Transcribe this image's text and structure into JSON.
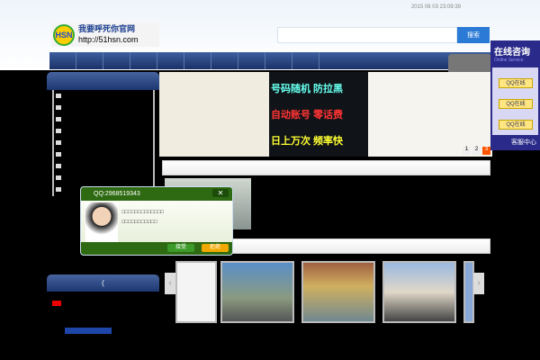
{
  "header": {
    "date": "2015 06 03  23:09:39",
    "logo_badge": "HSN",
    "logo_title": "我要呼死你官网",
    "logo_url": "http://51hsn.com",
    "search_placeholder": "",
    "search_button": "搜索"
  },
  "banner": {
    "lines": [
      "号码随机  防拉黑",
      "自动账号  零话费",
      "日上万次  频率快"
    ],
    "pages": [
      "1",
      "2",
      "3"
    ],
    "active_page": "3"
  },
  "left_panel": {
    "title2": "("
  },
  "qq_popup": {
    "title": "QQ:2968519343",
    "line1": "□□□□□□□□□□□□□",
    "line2": "□□□□□□□□□□□",
    "accept": "接受",
    "reject": "拒绝",
    "close": "✕"
  },
  "online_service": {
    "title": "在线咨询",
    "subtitle": "Online Service",
    "buttons": [
      "QQ在线",
      "QQ在线",
      "QQ在线"
    ],
    "footer": "客服中心"
  },
  "slider": {
    "prev": "‹",
    "next": "›"
  }
}
